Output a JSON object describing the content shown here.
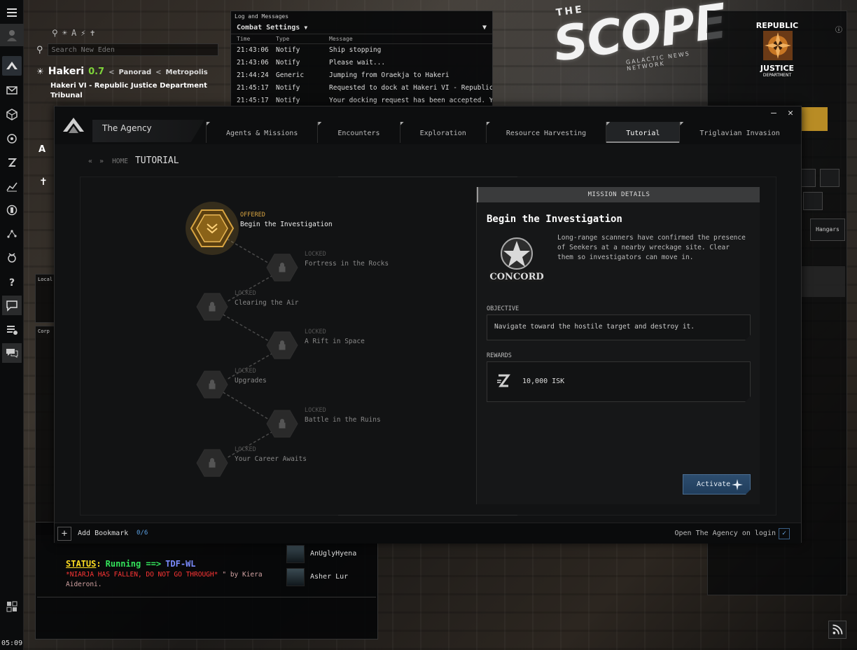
{
  "neocom": {
    "clock": "05:09"
  },
  "location": {
    "search_placeholder": "Search New Eden",
    "system": "Hakeri",
    "security": "0.7",
    "constellation": "Panorad",
    "region": "Metropolis",
    "station_line1": "Hakeri VI - Republic Justice Department",
    "station_line2": "Tribunal"
  },
  "log": {
    "window_title": "Log and Messages",
    "filter_label": "Combat Settings",
    "columns": {
      "time": "Time",
      "type": "Type",
      "message": "Message"
    },
    "rows": [
      {
        "time": "21:43:06",
        "type": "Notify",
        "message": "Ship stopping"
      },
      {
        "time": "21:43:06",
        "type": "Notify",
        "message": "Please wait..."
      },
      {
        "time": "21:44:24",
        "type": "Generic",
        "message": "Jumping from Oraekja to Hakeri"
      },
      {
        "time": "21:45:17",
        "type": "Notify",
        "message": "Requested to dock at Hakeri VI - Republic Justi"
      },
      {
        "time": "21:45:17",
        "type": "Notify",
        "message": "Your docking request has been accepted. Your"
      }
    ]
  },
  "scope": {
    "the": "THE",
    "word": "SCOPE",
    "sub": "GALACTIC NEWS NETWORK"
  },
  "corp_panel": {
    "logo_top": "REPUBLIC",
    "logo_mid": "JUSTICE",
    "logo_bottom": "DEPARTMENT",
    "hangars": "Hangars"
  },
  "side_windows": {
    "local": "Local",
    "corp": "Corp"
  },
  "agency": {
    "title": "The Agency",
    "tabs": [
      {
        "label": "Agents & Missions",
        "active": false
      },
      {
        "label": "Encounters",
        "active": false
      },
      {
        "label": "Exploration",
        "active": false
      },
      {
        "label": "Resource Harvesting",
        "active": false
      },
      {
        "label": "Tutorial",
        "active": true
      },
      {
        "label": "Triglavian Invasion",
        "active": false
      }
    ],
    "nav_home": "HOME",
    "nav_current": "TUTORIAL",
    "missions": [
      {
        "status": "OFFERED",
        "name": "Begin the Investigation"
      },
      {
        "status": "LOCKED",
        "name": "Fortress in the Rocks"
      },
      {
        "status": "LOCKED",
        "name": "Clearing the Air"
      },
      {
        "status": "LOCKED",
        "name": "A Rift in Space"
      },
      {
        "status": "LOCKED",
        "name": "Upgrades"
      },
      {
        "status": "LOCKED",
        "name": "Battle in the Ruins"
      },
      {
        "status": "LOCKED",
        "name": "Your Career Awaits"
      }
    ],
    "details": {
      "header": "MISSION DETAILS",
      "title": "Begin the Investigation",
      "emblem_text": "CONCORD",
      "description": "Long-range scanners have confirmed the presence of Seekers at a nearby wreckage site. Clear them so investigators can move in.",
      "objective_label": "OBJECTIVE",
      "objective": "Navigate toward the hostile target and destroy it.",
      "rewards_label": "REWARDS",
      "reward": "10,000 ISK",
      "activate": "Activate"
    },
    "footer": {
      "add_bookmark": "Add Bookmark",
      "bookmark_count": "0/6",
      "open_on_login": "Open The Agency on login"
    }
  },
  "chat": {
    "status_label": "STATUS",
    "status_running": "Running ==>",
    "status_target": "TDF-WL",
    "warning": "*NIARJA HAS FALLEN, DO NOT GO THROUGH*",
    "by": "\" by Kiera Aideroni.",
    "members": [
      "AnUglyHyena",
      "Asher Lur"
    ]
  },
  "colors": {
    "offered": "#d8a441",
    "security": "#7fd43a",
    "activate": "#2d4d6e",
    "status_running": "#33e25b",
    "warning": "#ff3535"
  }
}
